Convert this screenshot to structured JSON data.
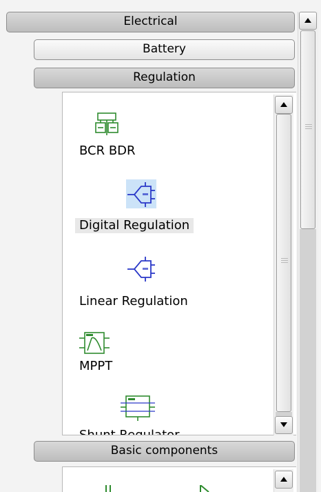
{
  "palette": {
    "categories": [
      {
        "label": "Electrical",
        "state": "open"
      },
      {
        "label": "Battery",
        "state": "closed"
      },
      {
        "label": "Regulation",
        "state": "open"
      },
      {
        "label": "Basic components",
        "state": "open"
      }
    ],
    "regulation_items": [
      {
        "label": "BCR BDR",
        "icon": "bcr-bdr-icon",
        "selected": false
      },
      {
        "label": "Digital Regulation",
        "icon": "digital-regulation-icon",
        "selected": true
      },
      {
        "label": "Linear Regulation",
        "icon": "linear-regulation-icon",
        "selected": false
      },
      {
        "label": "MPPT",
        "icon": "mppt-icon",
        "selected": false
      },
      {
        "label": "Shunt Regulator",
        "icon": "shunt-regulator-icon",
        "selected": false
      }
    ],
    "basic_components_items": [
      {
        "icon": "capacitor-icon"
      },
      {
        "icon": "diode-icon"
      }
    ],
    "colors": {
      "green": "#2e8b2e",
      "blue": "#2a38c8",
      "selection": "#cce3f8"
    }
  }
}
